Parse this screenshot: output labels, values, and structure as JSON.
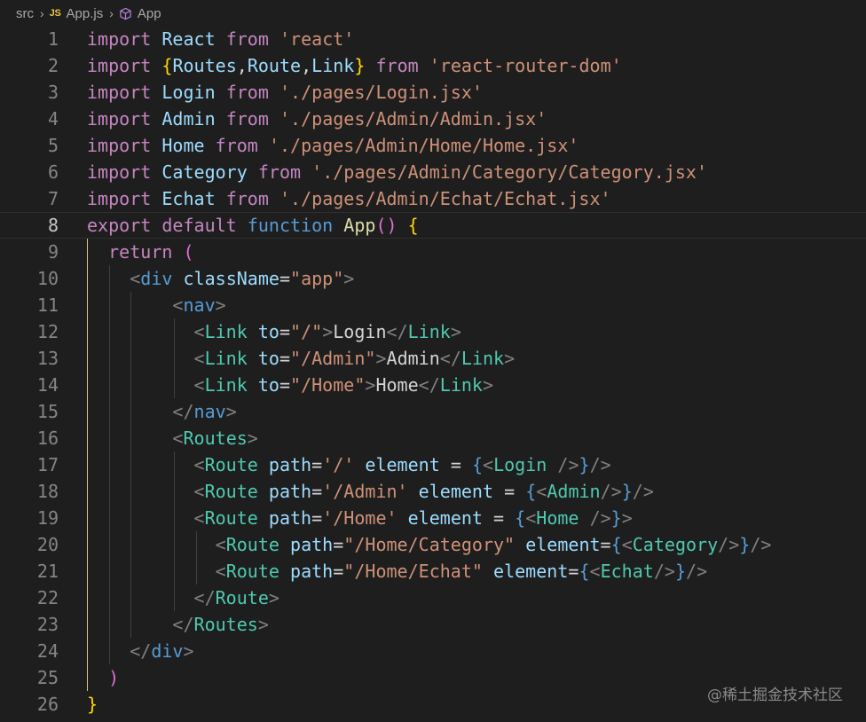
{
  "breadcrumb": {
    "folder": "src",
    "file": "App.js",
    "file_icon_label": "JS",
    "symbol": "App",
    "symbol_icon": "cube-icon"
  },
  "code_lines": [
    {
      "n": "1",
      "current": false,
      "guides": [],
      "t": [
        [
          "kw",
          "import"
        ],
        [
          "tx",
          " "
        ],
        [
          "id",
          "React"
        ],
        [
          "tx",
          " "
        ],
        [
          "kw",
          "from"
        ],
        [
          "tx",
          " "
        ],
        [
          "s",
          "'react'"
        ]
      ]
    },
    {
      "n": "2",
      "current": false,
      "guides": [],
      "t": [
        [
          "kw",
          "import"
        ],
        [
          "tx",
          " "
        ],
        [
          "b1",
          "{"
        ],
        [
          "id",
          "Routes"
        ],
        [
          "tx",
          ","
        ],
        [
          "id",
          "Route"
        ],
        [
          "tx",
          ","
        ],
        [
          "id",
          "Link"
        ],
        [
          "b1",
          "}"
        ],
        [
          "tx",
          " "
        ],
        [
          "kw",
          "from"
        ],
        [
          "tx",
          " "
        ],
        [
          "s",
          "'react-router-dom'"
        ]
      ]
    },
    {
      "n": "3",
      "current": false,
      "guides": [],
      "t": [
        [
          "kw",
          "import"
        ],
        [
          "tx",
          " "
        ],
        [
          "id",
          "Login"
        ],
        [
          "tx",
          " "
        ],
        [
          "kw",
          "from"
        ],
        [
          "tx",
          " "
        ],
        [
          "s",
          "'./pages/Login.jsx'"
        ]
      ]
    },
    {
      "n": "4",
      "current": false,
      "guides": [],
      "t": [
        [
          "kw",
          "import"
        ],
        [
          "tx",
          " "
        ],
        [
          "id",
          "Admin"
        ],
        [
          "tx",
          " "
        ],
        [
          "kw",
          "from"
        ],
        [
          "tx",
          " "
        ],
        [
          "s",
          "'./pages/Admin/Admin.jsx'"
        ]
      ]
    },
    {
      "n": "5",
      "current": false,
      "guides": [],
      "t": [
        [
          "kw",
          "import"
        ],
        [
          "tx",
          " "
        ],
        [
          "id",
          "Home"
        ],
        [
          "tx",
          " "
        ],
        [
          "kw",
          "from"
        ],
        [
          "tx",
          " "
        ],
        [
          "s",
          "'./pages/Admin/Home/Home.jsx'"
        ]
      ]
    },
    {
      "n": "6",
      "current": false,
      "guides": [],
      "t": [
        [
          "kw",
          "import"
        ],
        [
          "tx",
          " "
        ],
        [
          "id",
          "Category"
        ],
        [
          "tx",
          " "
        ],
        [
          "kw",
          "from"
        ],
        [
          "tx",
          " "
        ],
        [
          "s",
          "'./pages/Admin/Category/Category.jsx'"
        ]
      ]
    },
    {
      "n": "7",
      "current": false,
      "guides": [],
      "t": [
        [
          "kw",
          "import"
        ],
        [
          "tx",
          " "
        ],
        [
          "id",
          "Echat"
        ],
        [
          "tx",
          " "
        ],
        [
          "kw",
          "from"
        ],
        [
          "tx",
          " "
        ],
        [
          "s",
          "'./pages/Admin/Echat/Echat.jsx'"
        ]
      ]
    },
    {
      "n": "8",
      "current": true,
      "guides": [],
      "t": [
        [
          "kw",
          "export"
        ],
        [
          "tx",
          " "
        ],
        [
          "kw",
          "default"
        ],
        [
          "tx",
          " "
        ],
        [
          "st",
          "function"
        ],
        [
          "tx",
          " "
        ],
        [
          "fn",
          "App"
        ],
        [
          "b2",
          "()"
        ],
        [
          "tx",
          " "
        ],
        [
          "b1",
          "{"
        ]
      ]
    },
    {
      "n": "9",
      "current": false,
      "guides": [
        0
      ],
      "t": [
        [
          "tx",
          "  "
        ],
        [
          "kw",
          "return"
        ],
        [
          "tx",
          " "
        ],
        [
          "b2",
          "("
        ]
      ]
    },
    {
      "n": "10",
      "current": false,
      "guides": [
        0,
        1
      ],
      "t": [
        [
          "tx",
          "    "
        ],
        [
          "pc",
          "<"
        ],
        [
          "st",
          "div"
        ],
        [
          "tx",
          " "
        ],
        [
          "id",
          "className"
        ],
        [
          "op",
          "="
        ],
        [
          "s",
          "\"app\""
        ],
        [
          "pc",
          ">"
        ]
      ]
    },
    {
      "n": "11",
      "current": false,
      "guides": [
        0,
        1,
        2
      ],
      "t": [
        [
          "tx",
          "        "
        ],
        [
          "pc",
          "<"
        ],
        [
          "st",
          "nav"
        ],
        [
          "pc",
          ">"
        ]
      ]
    },
    {
      "n": "12",
      "current": false,
      "guides": [
        0,
        1,
        2,
        3
      ],
      "t": [
        [
          "tx",
          "          "
        ],
        [
          "pc",
          "<"
        ],
        [
          "tg",
          "Link"
        ],
        [
          "tx",
          " "
        ],
        [
          "id",
          "to"
        ],
        [
          "op",
          "="
        ],
        [
          "s",
          "\"/\""
        ],
        [
          "pc",
          ">"
        ],
        [
          "tx",
          "Login"
        ],
        [
          "pc",
          "</"
        ],
        [
          "tg",
          "Link"
        ],
        [
          "pc",
          ">"
        ]
      ]
    },
    {
      "n": "13",
      "current": false,
      "guides": [
        0,
        1,
        2,
        3
      ],
      "t": [
        [
          "tx",
          "          "
        ],
        [
          "pc",
          "<"
        ],
        [
          "tg",
          "Link"
        ],
        [
          "tx",
          " "
        ],
        [
          "id",
          "to"
        ],
        [
          "op",
          "="
        ],
        [
          "s",
          "\"/Admin\""
        ],
        [
          "pc",
          ">"
        ],
        [
          "tx",
          "Admin"
        ],
        [
          "pc",
          "</"
        ],
        [
          "tg",
          "Link"
        ],
        [
          "pc",
          ">"
        ]
      ]
    },
    {
      "n": "14",
      "current": false,
      "guides": [
        0,
        1,
        2,
        3
      ],
      "t": [
        [
          "tx",
          "          "
        ],
        [
          "pc",
          "<"
        ],
        [
          "tg",
          "Link"
        ],
        [
          "tx",
          " "
        ],
        [
          "id",
          "to"
        ],
        [
          "op",
          "="
        ],
        [
          "s",
          "\"/Home\""
        ],
        [
          "pc",
          ">"
        ],
        [
          "tx",
          "Home"
        ],
        [
          "pc",
          "</"
        ],
        [
          "tg",
          "Link"
        ],
        [
          "pc",
          ">"
        ]
      ]
    },
    {
      "n": "15",
      "current": false,
      "guides": [
        0,
        1,
        2
      ],
      "t": [
        [
          "tx",
          "        "
        ],
        [
          "pc",
          "</"
        ],
        [
          "st",
          "nav"
        ],
        [
          "pc",
          ">"
        ]
      ]
    },
    {
      "n": "16",
      "current": false,
      "guides": [
        0,
        1,
        2
      ],
      "t": [
        [
          "tx",
          "        "
        ],
        [
          "pc",
          "<"
        ],
        [
          "tg",
          "Routes"
        ],
        [
          "pc",
          ">"
        ]
      ]
    },
    {
      "n": "17",
      "current": false,
      "guides": [
        0,
        1,
        2,
        3
      ],
      "t": [
        [
          "tx",
          "          "
        ],
        [
          "pc",
          "<"
        ],
        [
          "tg",
          "Route"
        ],
        [
          "tx",
          " "
        ],
        [
          "id",
          "path"
        ],
        [
          "op",
          "="
        ],
        [
          "s",
          "'/'"
        ],
        [
          "tx",
          " "
        ],
        [
          "id",
          "element"
        ],
        [
          "tx",
          " "
        ],
        [
          "op",
          "="
        ],
        [
          "tx",
          " "
        ],
        [
          "st",
          "{"
        ],
        [
          "pc",
          "<"
        ],
        [
          "tg",
          "Login"
        ],
        [
          "tx",
          " "
        ],
        [
          "pc",
          "/>"
        ],
        [
          "st",
          "}"
        ],
        [
          "pc",
          "/>"
        ]
      ]
    },
    {
      "n": "18",
      "current": false,
      "guides": [
        0,
        1,
        2,
        3
      ],
      "t": [
        [
          "tx",
          "          "
        ],
        [
          "pc",
          "<"
        ],
        [
          "tg",
          "Route"
        ],
        [
          "tx",
          " "
        ],
        [
          "id",
          "path"
        ],
        [
          "op",
          "="
        ],
        [
          "s",
          "'/Admin'"
        ],
        [
          "tx",
          " "
        ],
        [
          "id",
          "element"
        ],
        [
          "tx",
          " "
        ],
        [
          "op",
          "="
        ],
        [
          "tx",
          " "
        ],
        [
          "st",
          "{"
        ],
        [
          "pc",
          "<"
        ],
        [
          "tg",
          "Admin"
        ],
        [
          "pc",
          "/>"
        ],
        [
          "st",
          "}"
        ],
        [
          "pc",
          "/>"
        ]
      ]
    },
    {
      "n": "19",
      "current": false,
      "guides": [
        0,
        1,
        2,
        3
      ],
      "t": [
        [
          "tx",
          "          "
        ],
        [
          "pc",
          "<"
        ],
        [
          "tg",
          "Route"
        ],
        [
          "tx",
          " "
        ],
        [
          "id",
          "path"
        ],
        [
          "op",
          "="
        ],
        [
          "s",
          "'/Home'"
        ],
        [
          "tx",
          " "
        ],
        [
          "id",
          "element"
        ],
        [
          "tx",
          " "
        ],
        [
          "op",
          "="
        ],
        [
          "tx",
          " "
        ],
        [
          "st",
          "{"
        ],
        [
          "pc",
          "<"
        ],
        [
          "tg",
          "Home"
        ],
        [
          "tx",
          " "
        ],
        [
          "pc",
          "/>"
        ],
        [
          "st",
          "}"
        ],
        [
          "pc",
          ">"
        ]
      ]
    },
    {
      "n": "20",
      "current": false,
      "guides": [
        0,
        1,
        2,
        3,
        4
      ],
      "t": [
        [
          "tx",
          "            "
        ],
        [
          "pc",
          "<"
        ],
        [
          "tg",
          "Route"
        ],
        [
          "tx",
          " "
        ],
        [
          "id",
          "path"
        ],
        [
          "op",
          "="
        ],
        [
          "s",
          "\"/Home/Category\""
        ],
        [
          "tx",
          " "
        ],
        [
          "id",
          "element"
        ],
        [
          "op",
          "="
        ],
        [
          "st",
          "{"
        ],
        [
          "pc",
          "<"
        ],
        [
          "tg",
          "Category"
        ],
        [
          "pc",
          "/>"
        ],
        [
          "st",
          "}"
        ],
        [
          "pc",
          "/>"
        ]
      ]
    },
    {
      "n": "21",
      "current": false,
      "guides": [
        0,
        1,
        2,
        3,
        4
      ],
      "t": [
        [
          "tx",
          "            "
        ],
        [
          "pc",
          "<"
        ],
        [
          "tg",
          "Route"
        ],
        [
          "tx",
          " "
        ],
        [
          "id",
          "path"
        ],
        [
          "op",
          "="
        ],
        [
          "s",
          "\"/Home/Echat\""
        ],
        [
          "tx",
          " "
        ],
        [
          "id",
          "element"
        ],
        [
          "op",
          "="
        ],
        [
          "st",
          "{"
        ],
        [
          "pc",
          "<"
        ],
        [
          "tg",
          "Echat"
        ],
        [
          "pc",
          "/>"
        ],
        [
          "st",
          "}"
        ],
        [
          "pc",
          "/>"
        ]
      ]
    },
    {
      "n": "22",
      "current": false,
      "guides": [
        0,
        1,
        2,
        3
      ],
      "t": [
        [
          "tx",
          "          "
        ],
        [
          "pc",
          "</"
        ],
        [
          "tg",
          "Route"
        ],
        [
          "pc",
          ">"
        ]
      ]
    },
    {
      "n": "23",
      "current": false,
      "guides": [
        0,
        1,
        2
      ],
      "t": [
        [
          "tx",
          "        "
        ],
        [
          "pc",
          "</"
        ],
        [
          "tg",
          "Routes"
        ],
        [
          "pc",
          ">"
        ]
      ]
    },
    {
      "n": "24",
      "current": false,
      "guides": [
        0,
        1
      ],
      "t": [
        [
          "tx",
          "    "
        ],
        [
          "pc",
          "</"
        ],
        [
          "st",
          "div"
        ],
        [
          "pc",
          ">"
        ]
      ]
    },
    {
      "n": "25",
      "current": false,
      "guides": [
        0
      ],
      "t": [
        [
          "tx",
          "  "
        ],
        [
          "b2",
          ")"
        ]
      ]
    },
    {
      "n": "26",
      "current": false,
      "guides": [],
      "t": [
        [
          "b1",
          "}"
        ]
      ]
    }
  ],
  "watermark": "@稀土掘金技术社区",
  "colors": {
    "background": "#1e1e1e",
    "keyword": "#c586c0",
    "storage": "#569cd6",
    "variable": "#9cdcfe",
    "function": "#dcdcaa",
    "string": "#ce9178",
    "component": "#4ec9b0",
    "active_guide": "#e2c08d"
  }
}
